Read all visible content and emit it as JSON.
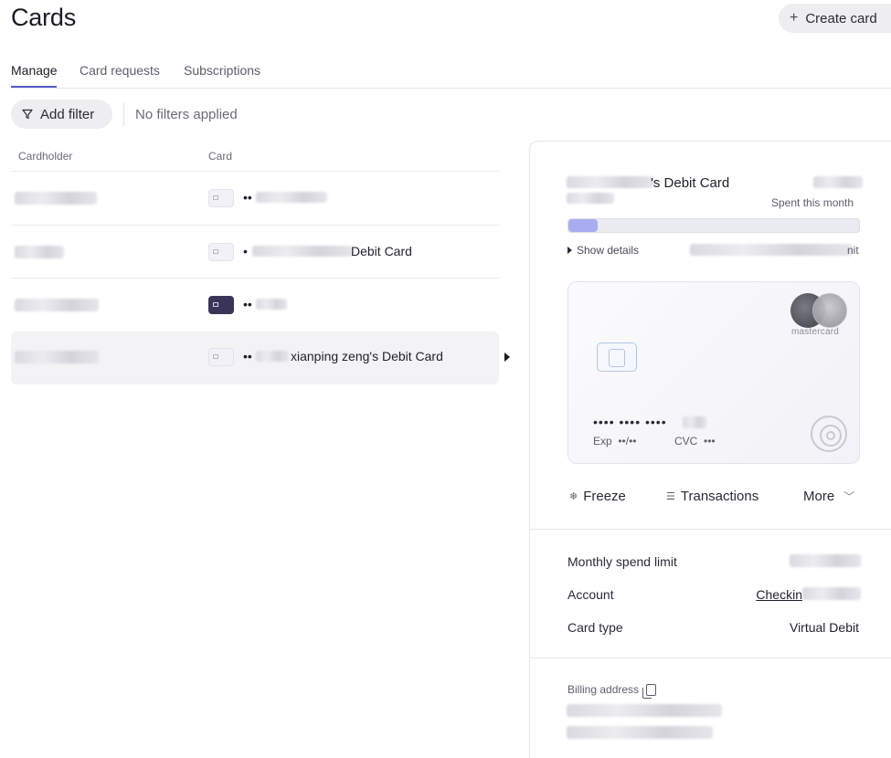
{
  "header": {
    "title": "Cards",
    "create_label": "Create card",
    "create_icon": "plus-icon"
  },
  "tabs": [
    {
      "label": "Manage",
      "active": true
    },
    {
      "label": "Card requests",
      "active": false
    },
    {
      "label": "Subscriptions",
      "active": false
    }
  ],
  "filters": {
    "add_label": "Add filter",
    "status": "No filters applied",
    "icon": "filter-icon"
  },
  "table": {
    "columns": [
      "Cardholder",
      "Card"
    ],
    "rows": [
      {
        "card_label": "••",
        "card_style": "light"
      },
      {
        "card_label": "•",
        "card_suffix": "Debit Card",
        "card_style": "light"
      },
      {
        "card_label": "••",
        "card_style": "dark"
      },
      {
        "card_label": "••",
        "card_suffix": "xianping zeng's Debit Card",
        "card_style": "light",
        "selected": true
      }
    ]
  },
  "panel": {
    "title_suffix": "'s Debit Card",
    "spent_label": "Spent this month",
    "spent_progress": 0.1,
    "show_details": "Show details",
    "limit_suffix": "nit",
    "card": {
      "brand": "mastercard",
      "number": "•••• •••• ••••",
      "exp_label": "Exp",
      "exp_value": "••/••",
      "cvc_label": "CVC",
      "cvc_value": "•••"
    },
    "actions": {
      "freeze": "Freeze",
      "transactions": "Transactions",
      "more": "More"
    },
    "details": [
      {
        "label": "Monthly spend limit",
        "value": ""
      },
      {
        "label": "Account",
        "value": "Checkin"
      },
      {
        "label": "Card type",
        "value": "Virtual Debit"
      }
    ],
    "billing_label": "Billing address"
  },
  "colors": {
    "accent": "#5659c8",
    "progress_fill": "#a9adf0",
    "dark_card": "#3a3558"
  }
}
